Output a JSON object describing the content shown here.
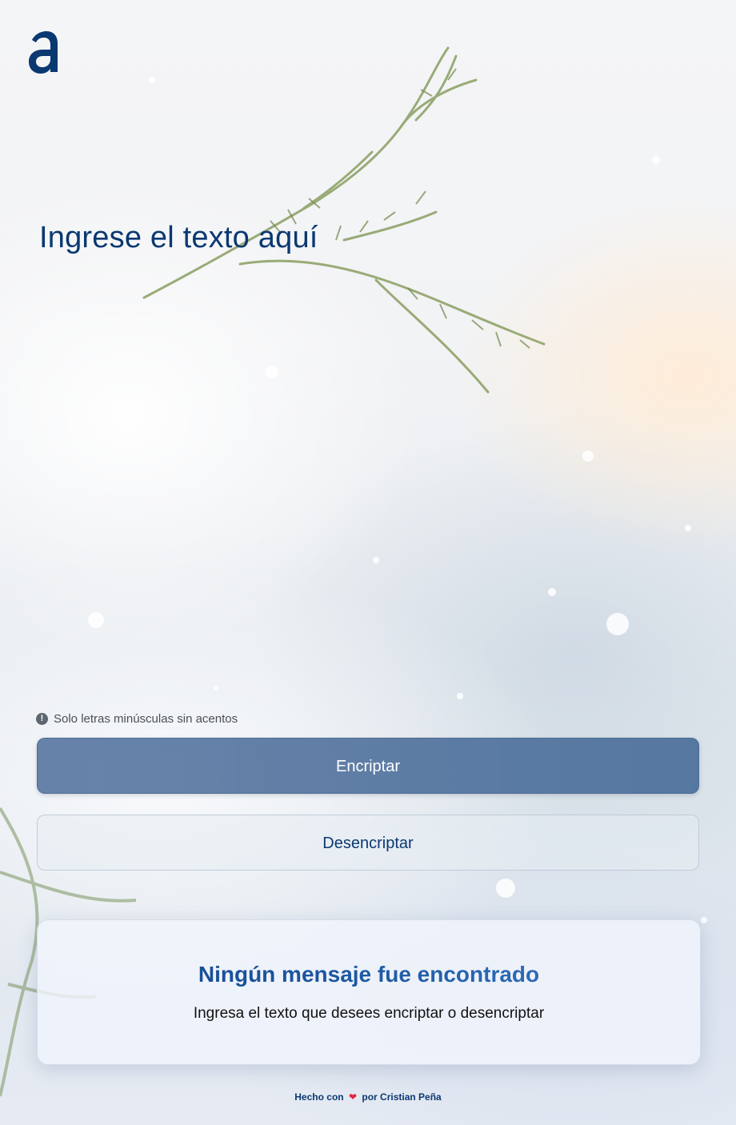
{
  "header": {
    "logo_icon": "alura-a-logo"
  },
  "input": {
    "placeholder": "Ingrese el texto aquí"
  },
  "hint": {
    "icon": "info-icon",
    "icon_glyph": "!",
    "text": "Solo letras minúsculas sin acentos"
  },
  "buttons": {
    "encrypt_label": "Encriptar",
    "decrypt_label": "Desencriptar"
  },
  "output": {
    "title": "Ningún mensaje fue encontrado",
    "message": "Ingresa el texto que desees encriptar o desencriptar"
  },
  "footer": {
    "prefix": "Hecho con",
    "heart_glyph": "❤",
    "suffix": "por Cristian Peña"
  },
  "colors": {
    "primary": "#0a3871",
    "heart": "#e5263a"
  }
}
